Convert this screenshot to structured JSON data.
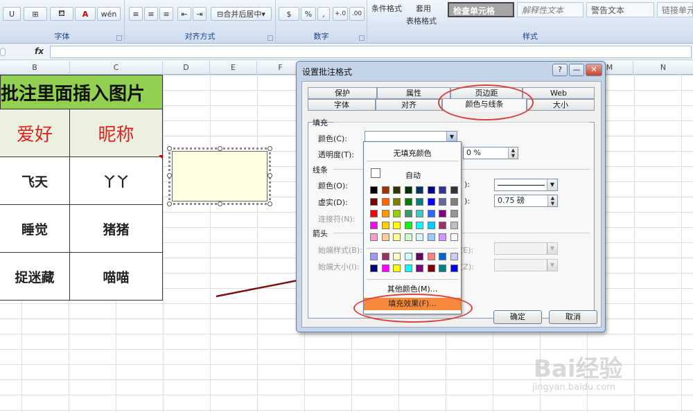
{
  "ribbon": {
    "groups": [
      {
        "label": "字体"
      },
      {
        "label": "对齐方式"
      },
      {
        "label": "数字"
      },
      {
        "label": "样式"
      }
    ],
    "font_buttons": [
      "U",
      "⊞",
      "A",
      "wén"
    ],
    "align_merge_label": "合并后居中",
    "number_buttons": [
      "%",
      ",",
      "+.0",
      ".00"
    ],
    "cond_format_label": "条件格式",
    "table_format_label_1": "套用",
    "table_format_label_2": "表格格式",
    "cell_styles": [
      "检查单元格",
      "解释性文本",
      "警告文本",
      "链接单元格"
    ]
  },
  "formula_bar": {
    "fx": "fx"
  },
  "columns": [
    "B",
    "C",
    "D",
    "E",
    "F",
    "M",
    "N"
  ],
  "sheet": {
    "title": "批注里面插入图片",
    "headers": [
      "爱好",
      "昵称"
    ],
    "rows": [
      [
        "飞天",
        "丫丫"
      ],
      [
        "睡觉",
        "猪猪"
      ],
      [
        "捉迷藏",
        "喵喵"
      ]
    ]
  },
  "dialog": {
    "title": "设置批注格式",
    "help_btn": "?",
    "min_btn": "—",
    "close_btn": "✕",
    "tabs_row1": [
      "保护",
      "属性",
      "页边距",
      "Web"
    ],
    "tabs_row2": [
      "字体",
      "对齐",
      "颜色与线条",
      "大小"
    ],
    "active_tab": "颜色与线条",
    "fill_section": "填充",
    "fill_color_label": "颜色(C):",
    "transparency_label": "透明度(T):",
    "transparency_value": "0 %",
    "line_section": "线条",
    "line_color_label": "颜色(O):",
    "dash_label": "虚实(D):",
    "connector_label": "连接符(N):",
    "style_label_suffix": "):",
    "weight_label_suffix": "):",
    "weight_value": "0.75 磅",
    "arrows_section": "箭头",
    "begin_style_label": "始端样式(B):",
    "begin_size_label": "始端大小(I):",
    "end_style_label": "末端样式(E):",
    "end_size_label": "末端大小(Z):",
    "ok_label": "确定",
    "cancel_label": "取消"
  },
  "palette": {
    "no_fill": "无填充颜色",
    "auto": "自动",
    "more_colors": "其他颜色(M)...",
    "fill_effects": "填充效果(F)...",
    "main_colors": [
      [
        "#000000",
        "#993300",
        "#333300",
        "#003300",
        "#003366",
        "#000080",
        "#333399",
        "#333333"
      ],
      [
        "#800000",
        "#ff6600",
        "#808000",
        "#008000",
        "#008080",
        "#0000ff",
        "#666699",
        "#808080"
      ],
      [
        "#ff0000",
        "#ff9900",
        "#99cc00",
        "#339966",
        "#33cccc",
        "#3366ff",
        "#800080",
        "#969696"
      ],
      [
        "#ff00ff",
        "#ffcc00",
        "#ffff00",
        "#00ff00",
        "#00ffff",
        "#00ccff",
        "#993366",
        "#c0c0c0"
      ],
      [
        "#ff99cc",
        "#ffcc99",
        "#ffff99",
        "#ccffcc",
        "#ccffff",
        "#99ccff",
        "#cc99ff",
        "#ffffff"
      ]
    ],
    "extra_colors": [
      [
        "#9999ff",
        "#993366",
        "#ffffcc",
        "#ccffff",
        "#660066",
        "#ff8080",
        "#0066cc",
        "#ccccff"
      ],
      [
        "#000080",
        "#ff00ff",
        "#ffff00",
        "#00ffff",
        "#800080",
        "#800000",
        "#008080",
        "#0000ff"
      ]
    ]
  },
  "watermark": {
    "brand": "Bai经验",
    "url": "jingyan.baidu.com"
  },
  "colors": {
    "highlight": "#d6413d",
    "arrow": "#7a1010",
    "fill_effects_bg": "#f7893a",
    "comment_bg": "#ffffe1"
  }
}
